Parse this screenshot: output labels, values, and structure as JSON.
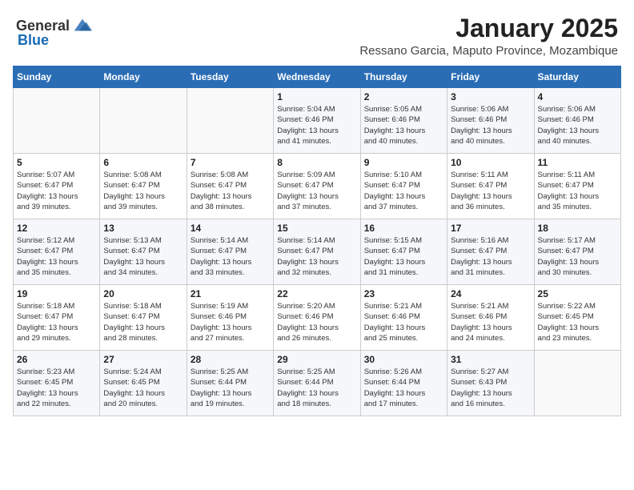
{
  "header": {
    "logo_general": "General",
    "logo_blue": "Blue",
    "month_title": "January 2025",
    "location": "Ressano Garcia, Maputo Province, Mozambique"
  },
  "weekdays": [
    "Sunday",
    "Monday",
    "Tuesday",
    "Wednesday",
    "Thursday",
    "Friday",
    "Saturday"
  ],
  "weeks": [
    [
      {
        "day": "",
        "info": ""
      },
      {
        "day": "",
        "info": ""
      },
      {
        "day": "",
        "info": ""
      },
      {
        "day": "1",
        "info": "Sunrise: 5:04 AM\nSunset: 6:46 PM\nDaylight: 13 hours\nand 41 minutes."
      },
      {
        "day": "2",
        "info": "Sunrise: 5:05 AM\nSunset: 6:46 PM\nDaylight: 13 hours\nand 40 minutes."
      },
      {
        "day": "3",
        "info": "Sunrise: 5:06 AM\nSunset: 6:46 PM\nDaylight: 13 hours\nand 40 minutes."
      },
      {
        "day": "4",
        "info": "Sunrise: 5:06 AM\nSunset: 6:46 PM\nDaylight: 13 hours\nand 40 minutes."
      }
    ],
    [
      {
        "day": "5",
        "info": "Sunrise: 5:07 AM\nSunset: 6:47 PM\nDaylight: 13 hours\nand 39 minutes."
      },
      {
        "day": "6",
        "info": "Sunrise: 5:08 AM\nSunset: 6:47 PM\nDaylight: 13 hours\nand 39 minutes."
      },
      {
        "day": "7",
        "info": "Sunrise: 5:08 AM\nSunset: 6:47 PM\nDaylight: 13 hours\nand 38 minutes."
      },
      {
        "day": "8",
        "info": "Sunrise: 5:09 AM\nSunset: 6:47 PM\nDaylight: 13 hours\nand 37 minutes."
      },
      {
        "day": "9",
        "info": "Sunrise: 5:10 AM\nSunset: 6:47 PM\nDaylight: 13 hours\nand 37 minutes."
      },
      {
        "day": "10",
        "info": "Sunrise: 5:11 AM\nSunset: 6:47 PM\nDaylight: 13 hours\nand 36 minutes."
      },
      {
        "day": "11",
        "info": "Sunrise: 5:11 AM\nSunset: 6:47 PM\nDaylight: 13 hours\nand 35 minutes."
      }
    ],
    [
      {
        "day": "12",
        "info": "Sunrise: 5:12 AM\nSunset: 6:47 PM\nDaylight: 13 hours\nand 35 minutes."
      },
      {
        "day": "13",
        "info": "Sunrise: 5:13 AM\nSunset: 6:47 PM\nDaylight: 13 hours\nand 34 minutes."
      },
      {
        "day": "14",
        "info": "Sunrise: 5:14 AM\nSunset: 6:47 PM\nDaylight: 13 hours\nand 33 minutes."
      },
      {
        "day": "15",
        "info": "Sunrise: 5:14 AM\nSunset: 6:47 PM\nDaylight: 13 hours\nand 32 minutes."
      },
      {
        "day": "16",
        "info": "Sunrise: 5:15 AM\nSunset: 6:47 PM\nDaylight: 13 hours\nand 31 minutes."
      },
      {
        "day": "17",
        "info": "Sunrise: 5:16 AM\nSunset: 6:47 PM\nDaylight: 13 hours\nand 31 minutes."
      },
      {
        "day": "18",
        "info": "Sunrise: 5:17 AM\nSunset: 6:47 PM\nDaylight: 13 hours\nand 30 minutes."
      }
    ],
    [
      {
        "day": "19",
        "info": "Sunrise: 5:18 AM\nSunset: 6:47 PM\nDaylight: 13 hours\nand 29 minutes."
      },
      {
        "day": "20",
        "info": "Sunrise: 5:18 AM\nSunset: 6:47 PM\nDaylight: 13 hours\nand 28 minutes."
      },
      {
        "day": "21",
        "info": "Sunrise: 5:19 AM\nSunset: 6:46 PM\nDaylight: 13 hours\nand 27 minutes."
      },
      {
        "day": "22",
        "info": "Sunrise: 5:20 AM\nSunset: 6:46 PM\nDaylight: 13 hours\nand 26 minutes."
      },
      {
        "day": "23",
        "info": "Sunrise: 5:21 AM\nSunset: 6:46 PM\nDaylight: 13 hours\nand 25 minutes."
      },
      {
        "day": "24",
        "info": "Sunrise: 5:21 AM\nSunset: 6:46 PM\nDaylight: 13 hours\nand 24 minutes."
      },
      {
        "day": "25",
        "info": "Sunrise: 5:22 AM\nSunset: 6:45 PM\nDaylight: 13 hours\nand 23 minutes."
      }
    ],
    [
      {
        "day": "26",
        "info": "Sunrise: 5:23 AM\nSunset: 6:45 PM\nDaylight: 13 hours\nand 22 minutes."
      },
      {
        "day": "27",
        "info": "Sunrise: 5:24 AM\nSunset: 6:45 PM\nDaylight: 13 hours\nand 20 minutes."
      },
      {
        "day": "28",
        "info": "Sunrise: 5:25 AM\nSunset: 6:44 PM\nDaylight: 13 hours\nand 19 minutes."
      },
      {
        "day": "29",
        "info": "Sunrise: 5:25 AM\nSunset: 6:44 PM\nDaylight: 13 hours\nand 18 minutes."
      },
      {
        "day": "30",
        "info": "Sunrise: 5:26 AM\nSunset: 6:44 PM\nDaylight: 13 hours\nand 17 minutes."
      },
      {
        "day": "31",
        "info": "Sunrise: 5:27 AM\nSunset: 6:43 PM\nDaylight: 13 hours\nand 16 minutes."
      },
      {
        "day": "",
        "info": ""
      }
    ]
  ]
}
